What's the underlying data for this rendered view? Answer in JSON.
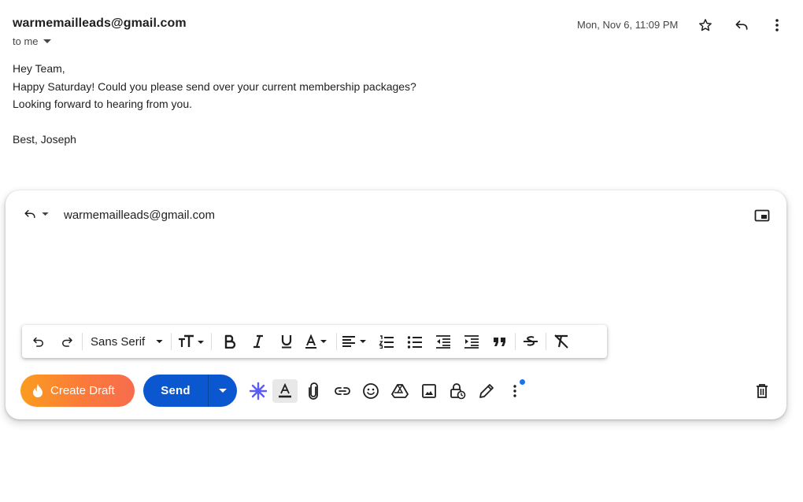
{
  "message": {
    "sender": "warmemailleads@gmail.com",
    "recipient_label": "to me",
    "timestamp": "Mon, Nov 6, 11:09 PM",
    "body": {
      "greeting": "Hey Team,",
      "line1": "Happy Saturday! Could you please send over your current membership packages?",
      "line2": "Looking forward to hearing from you.",
      "signoff": "Best, Joseph"
    }
  },
  "reply": {
    "to": "warmemailleads@gmail.com"
  },
  "format_toolbar": {
    "font": "Sans Serif"
  },
  "actions": {
    "create_draft_label": "Create Draft",
    "send_label": "Send"
  },
  "icons": [
    "undo-icon",
    "redo-icon",
    "text-size-icon",
    "bold-icon",
    "italic-icon",
    "underline-icon",
    "text-color-icon",
    "align-icon",
    "numbered-list-icon",
    "bulleted-list-icon",
    "indent-less-icon",
    "indent-more-icon",
    "quote-icon",
    "strikethrough-icon",
    "clear-format-icon",
    "flame-icon",
    "ai-sparkle-icon",
    "formatting-icon",
    "attach-icon",
    "link-icon",
    "emoji-icon",
    "drive-icon",
    "photo-icon",
    "confidential-lock-icon",
    "signature-pen-icon",
    "more-options-icon",
    "trash-icon",
    "star-icon",
    "reply-icon",
    "popout-icon"
  ],
  "colors": {
    "send_blue": "#0b57d0",
    "create_draft_gradient_start": "#fb9c1f",
    "create_draft_gradient_end": "#f76c4e",
    "ai_sparkle": "#5b5bf5",
    "notification_dot": "#1a73e8"
  }
}
